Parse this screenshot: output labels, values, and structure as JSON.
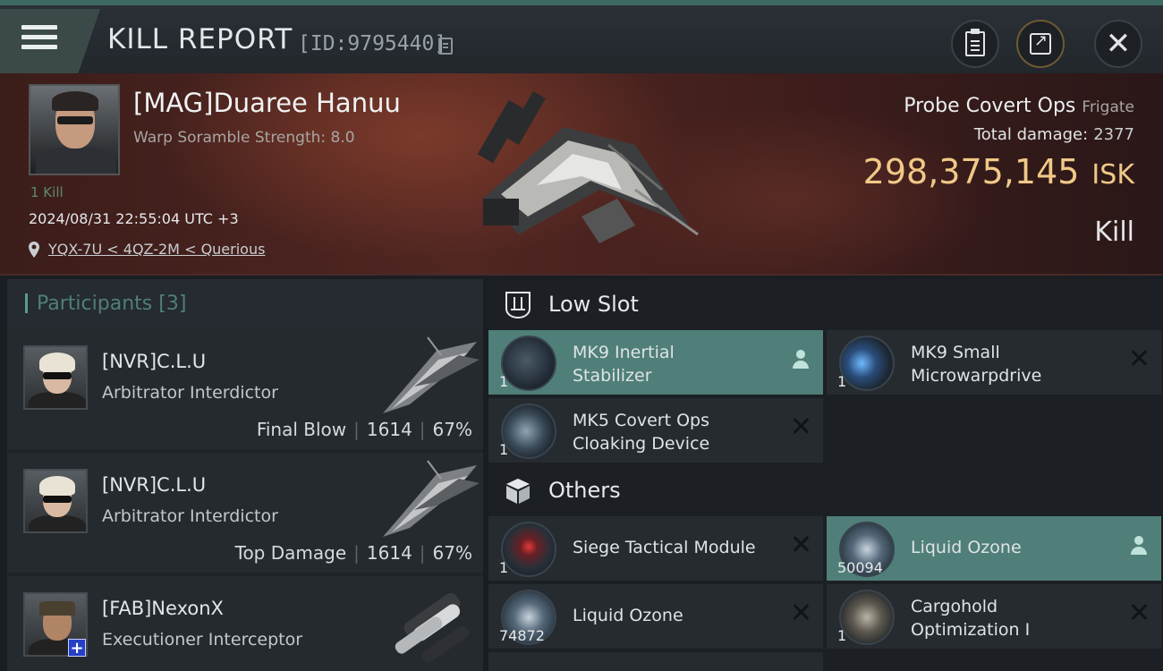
{
  "header": {
    "title": "KILL REPORT",
    "report_id": "[ID:9795440]"
  },
  "victim": {
    "name": "[MAG]Duaree Hanuu",
    "warp_scramble": "Warp Soramble Strength: 8.0",
    "kill_count": "1 Kill",
    "timestamp": "2024/08/31 22:55:04 UTC +3",
    "location": "YQX-7U < 4QZ-2M < Querious",
    "ship_name": "Probe Covert Ops",
    "ship_class": "Frigate",
    "total_damage_label": "Total damage:",
    "total_damage": "2377",
    "isk_value": "298,375,145",
    "isk_unit": "ISK",
    "result": "Kill"
  },
  "participants": {
    "title": "Participants",
    "count": "[3]",
    "rows": [
      {
        "name": "[NVR]C.L.U",
        "ship": "Arbitrator Interdictor",
        "role": "Final Blow",
        "damage": "1614",
        "percent": "67%"
      },
      {
        "name": "[NVR]C.L.U",
        "ship": "Arbitrator Interdictor",
        "role": "Top Damage",
        "damage": "1614",
        "percent": "67%"
      },
      {
        "name": "[FAB]NexonX",
        "ship": "Executioner Interceptor",
        "role": "",
        "damage": "",
        "percent": ""
      }
    ]
  },
  "modules": {
    "low_slot_label": "Low Slot",
    "others_label": "Others",
    "low_slot": [
      {
        "name_line1": "MK9 Inertial",
        "name_line2": "Stabilizer",
        "qty": "1",
        "status": "dropped"
      },
      {
        "name_line1": "MK9 Small",
        "name_line2": "Microwarpdrive",
        "qty": "1",
        "status": "destroyed"
      },
      {
        "name_line1": "MK5 Covert Ops",
        "name_line2": "Cloaking Device",
        "qty": "1",
        "status": "destroyed"
      }
    ],
    "others": [
      {
        "name": "Siege Tactical Module",
        "qty": "1",
        "status": "destroyed"
      },
      {
        "name": "Liquid Ozone",
        "qty": "50094",
        "status": "dropped"
      },
      {
        "name": "Liquid Ozone",
        "qty": "74872",
        "status": "destroyed"
      },
      {
        "name_line1": "Cargohold",
        "name_line2": "Optimization I",
        "qty": "1",
        "status": "destroyed"
      }
    ]
  },
  "colors": {
    "accent": "#4f7f78",
    "isk": "#f0c987",
    "hero_bg": "#512622"
  }
}
